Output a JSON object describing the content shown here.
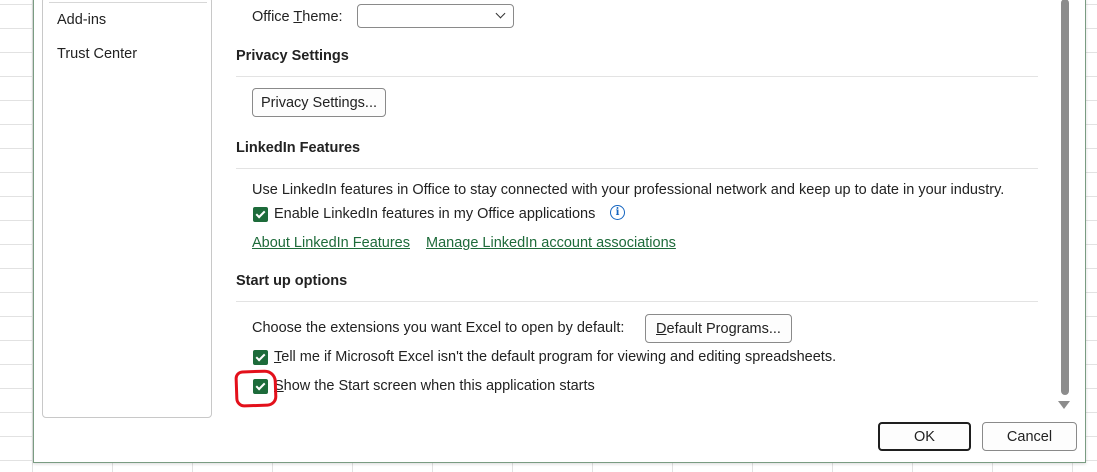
{
  "nav": {
    "items": [
      "Add-ins",
      "Trust Center"
    ]
  },
  "office_theme": {
    "label_prefix": "Office ",
    "label_accel": "T",
    "label_suffix": "heme:",
    "value": ""
  },
  "privacy": {
    "title": "Privacy Settings",
    "button_label": "Privacy Settings..."
  },
  "linkedin": {
    "title": "LinkedIn Features",
    "description": "Use LinkedIn features in Office to stay connected with your professional network and keep up to date in your industry.",
    "enable_label": "Enable LinkedIn features in my Office applications",
    "enable_checked": true,
    "about_link": "About LinkedIn Features",
    "manage_link": "Manage LinkedIn account associations"
  },
  "startup": {
    "title": "Start up options",
    "choose_text": "Choose the extensions you want Excel to open by default:",
    "default_programs_accel": "D",
    "default_programs_rest": "efault Programs...",
    "tell_me_accel": "T",
    "tell_me_rest": "ell me if Microsoft Excel isn't the default program for viewing and editing spreadsheets.",
    "tell_me_checked": true,
    "show_start_accel": "S",
    "show_start_rest": "how the Start screen when this application starts",
    "show_start_checked": true
  },
  "footer": {
    "ok_label": "OK",
    "cancel_label": "Cancel"
  },
  "colors": {
    "accent": "#1d6b3a",
    "annotation": "#e3101b"
  }
}
